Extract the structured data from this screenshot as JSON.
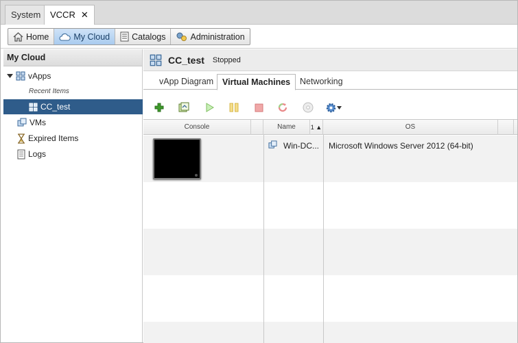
{
  "top_tabs": [
    {
      "label": "System"
    },
    {
      "label": "VCCR",
      "close": "✕"
    }
  ],
  "nav": {
    "home": "Home",
    "my_cloud": "My Cloud",
    "catalogs": "Catalogs",
    "administration": "Administration"
  },
  "sidebar": {
    "header": "My Cloud",
    "vapps": "vApps",
    "recent_items": "Recent Items",
    "cc_test": "CC_test",
    "vms": "VMs",
    "expired": "Expired Items",
    "logs": "Logs"
  },
  "vapp": {
    "name": "CC_test",
    "status": "Stopped"
  },
  "sub_tabs": {
    "diagram": "vApp Diagram",
    "vms": "Virtual Machines",
    "networking": "Networking"
  },
  "table": {
    "col_console": "Console",
    "col_name": "Name",
    "col_sort": "1 ▲",
    "col_os": "OS",
    "rows": [
      {
        "name": "Win-DC...",
        "os": "Microsoft Windows Server 2012 (64-bit)"
      }
    ]
  },
  "colors": {
    "accent": "#2f5c8a",
    "active_nav": "#a9cbef",
    "row_alt": "#f2f2f2"
  }
}
